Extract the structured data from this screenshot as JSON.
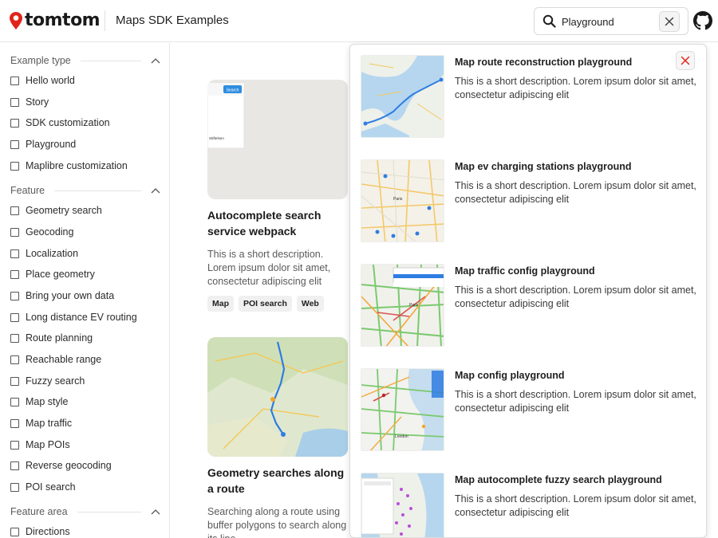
{
  "header": {
    "logo_text": "tomtom",
    "title": "Maps SDK Examples",
    "search": {
      "value": "Playground",
      "placeholder": "Search"
    },
    "brand_color": "#e2231a"
  },
  "sidebar": {
    "sections": [
      {
        "label": "Example type",
        "items": [
          "Hello world",
          "Story",
          "SDK customization",
          "Playground",
          "Maplibre customization"
        ]
      },
      {
        "label": "Feature",
        "items": [
          "Geometry search",
          "Geocoding",
          "Localization",
          "Place geometry",
          "Bring your own data",
          "Long distance EV routing",
          "Route planning",
          "Reachable range",
          "Fuzzy search",
          "Map style",
          "Map traffic",
          "Map POIs",
          "Reverse geocoding",
          "POI search"
        ]
      },
      {
        "label": "Feature area",
        "items": [
          "Directions"
        ]
      }
    ]
  },
  "cards": [
    {
      "title": "Autocomplete search service webpack",
      "description": "This is a short description. Lorem ipsum dolor sit amet, consectetur adipiscing elit",
      "tags": [
        "Map",
        "POI search",
        "Web"
      ],
      "thumb_button": "Search",
      "thumb_text": "Stiftelsen"
    },
    {
      "title": "Geometry searches along a route",
      "description": "Searching along a route using buffer polygons to search along its line.",
      "tags": []
    }
  ],
  "dropdown": {
    "results": [
      {
        "title": "Map route reconstruction playground",
        "description": "This is a short description. Lorem ipsum dolor sit amet, consectetur adipiscing elit",
        "thumb": "route-map"
      },
      {
        "title": "Map ev charging stations playground",
        "description": "This is a short description. Lorem ipsum dolor sit amet, consectetur adipiscing elit",
        "thumb": "paris-ev-map",
        "thumb_label": "Paris"
      },
      {
        "title": "Map traffic config playground",
        "description": "This is a short description. Lorem ipsum dolor sit amet, consectetur adipiscing elit",
        "thumb": "traffic-map",
        "thumb_label": "Paris"
      },
      {
        "title": "Map config playground",
        "description": "This is a short description. Lorem ipsum dolor sit amet, consectetur adipiscing elit",
        "thumb": "london-map",
        "thumb_label": "London"
      },
      {
        "title": "Map autocomplete fuzzy search playground",
        "description": "This is a short description. Lorem ipsum dolor sit amet, consectetur adipiscing elit",
        "thumb": "fuzzy-map"
      }
    ]
  },
  "icons": {
    "logo": "tomtom-pin-icon",
    "search": "search-icon",
    "clear": "close-icon",
    "github": "github-icon",
    "collapse": "chevron-up-icon"
  }
}
